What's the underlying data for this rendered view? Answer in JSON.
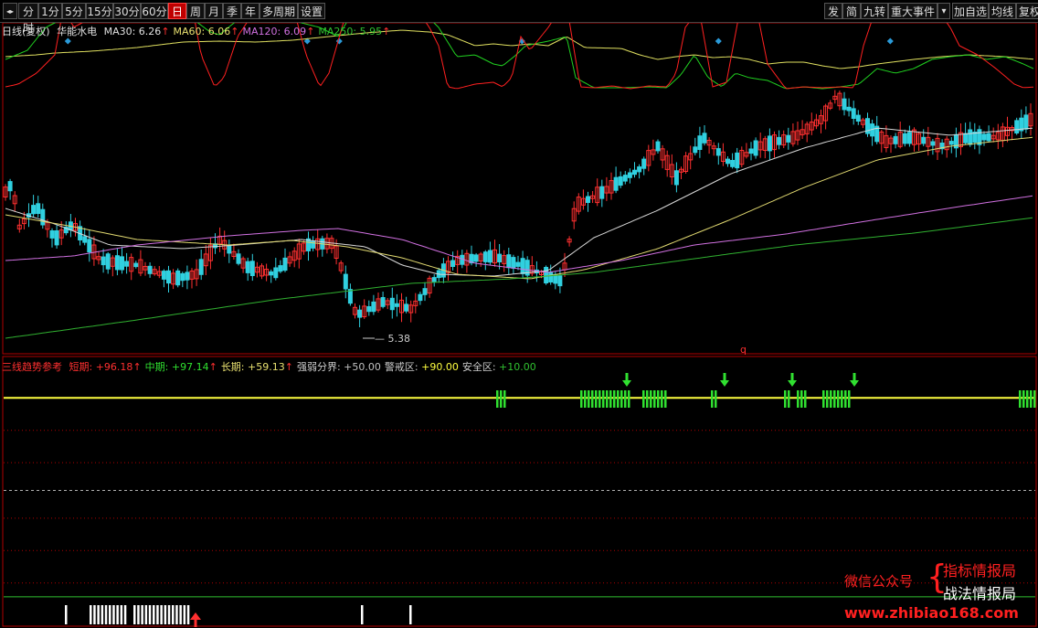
{
  "toolbar": {
    "left_items": [
      {
        "label": "分时",
        "name": "tab-fenshi"
      },
      {
        "label": "1分",
        "name": "tab-1min"
      },
      {
        "label": "5分",
        "name": "tab-5min"
      },
      {
        "label": "15分",
        "name": "tab-15min"
      },
      {
        "label": "30分",
        "name": "tab-30min"
      },
      {
        "label": "60分",
        "name": "tab-60min"
      },
      {
        "label": "日",
        "name": "tab-day",
        "active": true
      },
      {
        "label": "周",
        "name": "tab-week"
      },
      {
        "label": "月",
        "name": "tab-month"
      },
      {
        "label": "季",
        "name": "tab-quarter"
      },
      {
        "label": "年",
        "name": "tab-year"
      },
      {
        "label": "多周期",
        "name": "tab-multi-period"
      },
      {
        "label": "设置",
        "name": "settings-button"
      }
    ],
    "right_items": [
      {
        "label": "发",
        "name": "fa-button"
      },
      {
        "label": "简",
        "name": "jian-button"
      },
      {
        "label": "九转",
        "name": "jiuzhuan-button"
      },
      {
        "label": "重大事件",
        "name": "major-events-button"
      },
      {
        "label": "▾",
        "name": "dropdown-toggle"
      },
      {
        "label": "加自选",
        "name": "add-watchlist-button"
      },
      {
        "label": "均线",
        "name": "ma-button"
      },
      {
        "label": "复权",
        "name": "adjust-button"
      }
    ],
    "back_icon": "◂▸"
  },
  "price_panel": {
    "period": "日线(复权)",
    "stock_name": "华能水电",
    "ma": [
      {
        "label": "MA30: 6.26",
        "color": "#e0e0e0"
      },
      {
        "label": "MA60: 6.06",
        "color": "#e8e070"
      },
      {
        "label": "MA120: 6.09",
        "color": "#d070e0"
      },
      {
        "label": "MA250: 5.95",
        "color": "#30c030"
      }
    ],
    "arrow_up": "↑",
    "low_label": "5.38",
    "low_value": 5.38,
    "q_marker": "q"
  },
  "indicator_panel": {
    "name": "三线趋势参考",
    "items": [
      {
        "label": "短期:",
        "value": "+96.18",
        "color": "#ff3030"
      },
      {
        "label": "中期:",
        "value": "+97.14",
        "color": "#30e030"
      },
      {
        "label": "长期:",
        "value": "+59.13",
        "color": "#e8e070"
      },
      {
        "label": "强弱分界:",
        "value": "+50.00",
        "color": "#c0c0c0"
      },
      {
        "label": "警戒区:",
        "value": "+90.00",
        "color": "#ffff40"
      },
      {
        "label": "安全区:",
        "value": "+10.00",
        "color": "#30c030"
      }
    ],
    "arrow_up": "↑"
  },
  "watermark": {
    "wechat": "微信公众号",
    "line1": "指标情报局",
    "line2": "战法情报局",
    "url": "www.zhibiao168.com",
    "brace": "{"
  },
  "colors": {
    "up": "#ff3030",
    "down": "#30d0e0",
    "ma30": "#d8d8d8",
    "ma60": "#e0d870",
    "ma120": "#d070e0",
    "ma250": "#30b030",
    "short": "#ff2020",
    "mid": "#20d020",
    "long": "#e0e060"
  }
}
